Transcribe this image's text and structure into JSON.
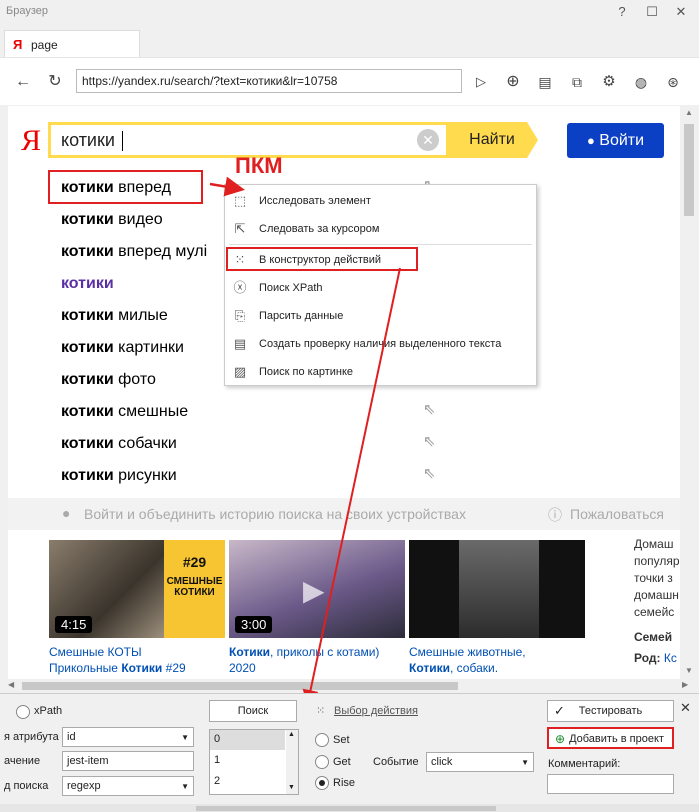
{
  "window": {
    "title": "Браузер"
  },
  "tab": {
    "logo": "Я",
    "label": "page"
  },
  "nav": {
    "url": "https://yandex.ru/search/?text=котики&lr=10758"
  },
  "yandex": {
    "logo": "Я",
    "query": "котики",
    "search_button": "Найти",
    "login_button": "Войти",
    "suggestions": [
      {
        "bold": "котики",
        "rest": " вперед"
      },
      {
        "bold": "котики",
        "rest": " видео"
      },
      {
        "bold": "котики",
        "rest": " вперед мулі"
      },
      {
        "bold": "котики",
        "rest": ""
      },
      {
        "bold": "котики",
        "rest": " милые"
      },
      {
        "bold": "котики",
        "rest": " картинки"
      },
      {
        "bold": "котики",
        "rest": " фото"
      },
      {
        "bold": "котики",
        "rest": " смешные"
      },
      {
        "bold": "котики",
        "rest": " собачки"
      },
      {
        "bold": "котики",
        "rest": " рисунки"
      }
    ],
    "history_text": "Войти и объединить историю поиска на своих устройствах",
    "complain": "Пожаловаться",
    "videos": [
      {
        "duration": "4:15",
        "title1": "Смешные КОТЫ",
        "title2": "Прикольные ",
        "title2b": "Котики",
        "title2c": " #29",
        "overlay1": "#29",
        "overlay2": "СМЕШНЫЕ",
        "overlay3": "КОТИКИ"
      },
      {
        "duration": "3:00",
        "title1b": "Котики",
        "title1": ", приколы с котами)",
        "title2": "2020"
      },
      {
        "title1": "Смешные животные,",
        "title2b": "Котики",
        "title2": ", собаки."
      }
    ],
    "side_text": [
      "Домаш",
      "популяр",
      "точки з",
      "домашн",
      "семейс"
    ],
    "side_bold": "Семей",
    "side_rod_label": "Род:",
    "side_rod_value": "Кс"
  },
  "annotation": {
    "pkm": "ПКМ"
  },
  "context_menu": [
    {
      "icon": "inspect-icon",
      "label": "Исследовать элемент"
    },
    {
      "icon": "cursor-follow-icon",
      "label": "Следовать за курсором"
    },
    {
      "icon": "constructor-icon",
      "label": "В конструктор действий"
    },
    {
      "icon": "xpath-icon",
      "label": "Поиск XPath"
    },
    {
      "icon": "parse-icon",
      "label": "Парсить данные"
    },
    {
      "icon": "text-check-icon",
      "label": "Создать проверку наличия выделенного текста"
    },
    {
      "icon": "image-search-icon",
      "label": "Поиск по картинке"
    }
  ],
  "panel": {
    "xpath_label": "xPath",
    "attr_label": "я атрибута",
    "attr_value": "id",
    "value_label": "ачение",
    "value_value": "јest-item",
    "search_type_label": "д поиска",
    "search_type_value": "regexp",
    "search_button": "Поиск",
    "list": [
      "0",
      "1",
      "2"
    ],
    "action_choice": "Выбор действия",
    "radios": [
      "Set",
      "Get",
      "Rise"
    ],
    "event_label": "Событие",
    "event_value": "click",
    "test_button": "Тестировать",
    "add_button": "Добавить в проект",
    "comment_label": "Комментарий:"
  }
}
